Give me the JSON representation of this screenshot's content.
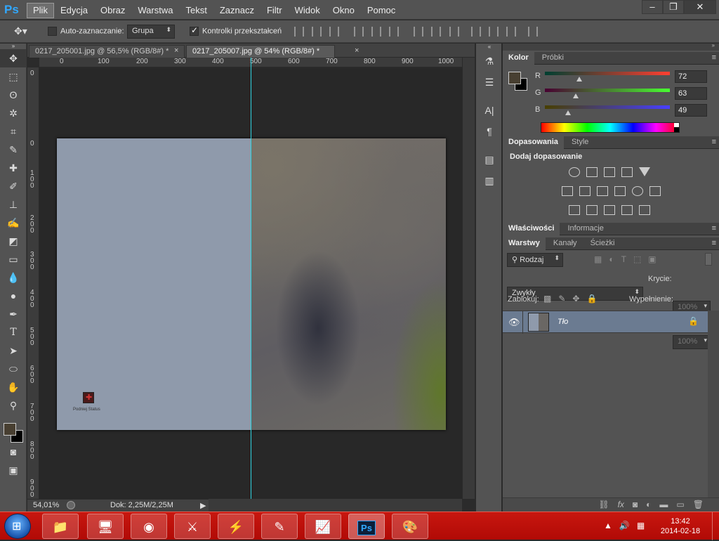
{
  "menubar": {
    "logo": "Ps",
    "items": [
      "Plik",
      "Edycja",
      "Obraz",
      "Warstwa",
      "Tekst",
      "Zaznacz",
      "Filtr",
      "Widok",
      "Okno",
      "Pomoc"
    ],
    "active_item": "Plik",
    "win_minimize": "–",
    "win_restore": "❐",
    "win_close": "✕"
  },
  "options": {
    "auto_select_label": "Auto-zaznaczanie:",
    "auto_select_checked": false,
    "group_select": "Grupa",
    "transform_controls_label": "Kontrolki przekształceń",
    "transform_controls_checked": true
  },
  "tabs": [
    {
      "label": "0217_205001.jpg @ 56,5% (RGB/8#) *",
      "active": false,
      "close": "×"
    },
    {
      "label": "0217_205007.jpg @ 54% (RGB/8#) *",
      "active": true,
      "close": "×"
    }
  ],
  "ruler_top": [
    "0",
    "100",
    "200",
    "300",
    "400",
    "500",
    "600",
    "700",
    "800",
    "900",
    "1000"
  ],
  "ruler_left": [
    "0",
    "0",
    "1 0 0",
    "2 0 0",
    "3 0 0",
    "4 0 0",
    "5 0 0",
    "6 0 0",
    "7 0 0",
    "8 0 0",
    "9 0 0"
  ],
  "canvas": {
    "small_icon_label": "Podniej Status"
  },
  "status": {
    "zoom": "54,01%",
    "doc": "Dok: 2,25M/2,25M"
  },
  "color_panel": {
    "tabs": [
      "Kolor",
      "Próbki"
    ],
    "r_label": "R",
    "g_label": "G",
    "b_label": "B",
    "r": "72",
    "g": "63",
    "b": "49",
    "fg_color": "#483f31",
    "bg_color": "#000000"
  },
  "adjustments_panel": {
    "tabs": [
      "Dopasowania",
      "Style"
    ],
    "title": "Dodaj dopasowanie"
  },
  "properties_panel": {
    "tabs": [
      "Właściwości",
      "Informacje"
    ]
  },
  "layers_panel": {
    "tabs": [
      "Warstwy",
      "Kanały",
      "Ścieżki"
    ],
    "filter_kind": "Rodzaj",
    "blend_mode": "Zwykły",
    "opacity_label": "Krycie:",
    "opacity": "100%",
    "lock_label": "Zablokuj:",
    "fill_label": "Wypełnienie:",
    "fill": "100%",
    "layers": [
      {
        "name": "Tło",
        "visible": true,
        "locked": true
      }
    ]
  },
  "taskbar": {
    "time": "13:42",
    "date": "2014-02-18"
  }
}
